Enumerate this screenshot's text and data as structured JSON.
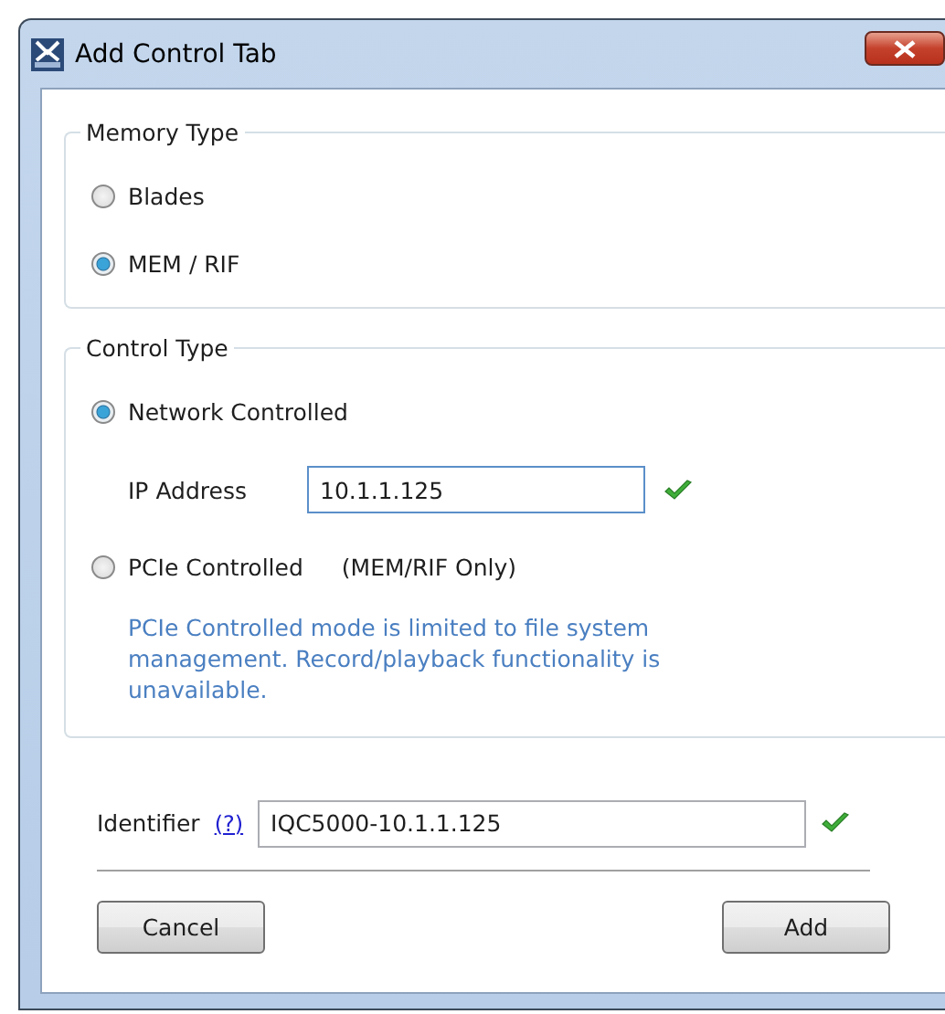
{
  "window": {
    "title": "Add Control Tab"
  },
  "memory_type": {
    "title": "Memory Type",
    "options": [
      {
        "label": "Blades",
        "selected": false
      },
      {
        "label": "MEM / RIF",
        "selected": true
      }
    ]
  },
  "control_type": {
    "title": "Control Type",
    "options": [
      {
        "label": "Network Controlled",
        "selected": true
      },
      {
        "label": "PCIe Controlled",
        "selected": false,
        "note": "(MEM/RIF Only)"
      }
    ],
    "ip_address": {
      "label": "IP Address",
      "value": "10.1.1.125",
      "valid": true
    },
    "info": "PCIe Controlled mode is limited to file system management.  Record/playback functionality is unavailable."
  },
  "identifier": {
    "label": "Identifier",
    "help": "(?)",
    "value": "IQC5000-10.1.1.125",
    "valid": true
  },
  "buttons": [
    {
      "label": "Cancel"
    },
    {
      "label": "Add"
    }
  ]
}
